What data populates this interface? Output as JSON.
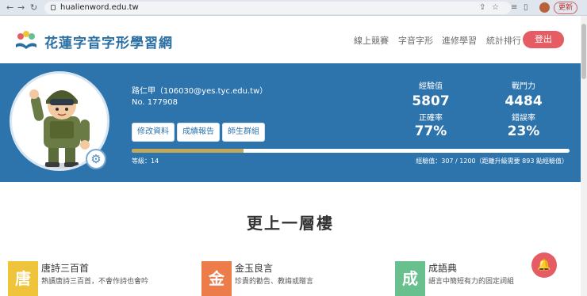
{
  "browser": {
    "url": "hualienword.edu.tw",
    "update_label": "更新"
  },
  "header": {
    "brand": "花蓮字音字形學習網",
    "menu": [
      "線上競賽",
      "字音字形",
      "進修學習",
      "統計排行"
    ],
    "login_label": "登出"
  },
  "profile": {
    "email": "路仁甲（106030@yes.tyc.edu.tw）",
    "number": "No. 177908",
    "buttons": [
      "修改資料",
      "成績報告",
      "師生群組"
    ],
    "stats": {
      "exp_label": "經驗值",
      "exp_value": "5807",
      "power_label": "戰鬥力",
      "power_value": "4484",
      "accuracy_label": "正確率",
      "accuracy_value": "77%",
      "error_label": "錯誤率",
      "error_value": "23%"
    },
    "level_text": "等級：14",
    "exp_text": "經驗值：307 / 1200（距離升級需要 893 點經驗值）",
    "exp_progress": 0.256
  },
  "section": {
    "title": "更上一層樓",
    "cards": [
      {
        "icon_char": "唐",
        "color": "#f0c43a",
        "title": "唐詩三百首",
        "desc": "熟讀唐詩三百首，不會作詩也會吟"
      },
      {
        "icon_char": "金",
        "color": "#ec7d4b",
        "title": "金玉良言",
        "desc": "珍貴的勸告、教誨或贈言"
      },
      {
        "icon_char": "成",
        "color": "#68c08f",
        "title": "成語典",
        "desc": "語言中簡短有力的固定詞組"
      }
    ]
  },
  "colors": {
    "band": "#2d74ad",
    "accent": "#e55c65",
    "brand": "#2a6fa4"
  }
}
